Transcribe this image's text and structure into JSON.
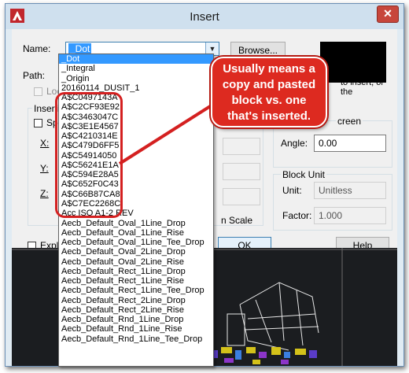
{
  "window": {
    "title": "Insert",
    "close_label": "✕"
  },
  "form": {
    "name_label": "Name:",
    "name_value": "_Dot",
    "browse_label": "Browse...",
    "path_label": "Path:",
    "locate_label": "Loca",
    "insertion_label": "Insertio",
    "specify_label": "Spe",
    "x_label": "X:",
    "y_label": "Y:",
    "z_label": "Z:",
    "explode_label": "Explo",
    "help_text_fragment": "to insert, or the",
    "screen_fragment": "creen",
    "angle_label": "Angle:",
    "angle_value": "0.00",
    "block_unit_label": "Block Unit",
    "unit_label": "Unit:",
    "unit_value": "Unitless",
    "factor_label": "Factor:",
    "factor_value": "1.000",
    "scale_fragment": "n Scale",
    "ok_label": "OK",
    "help_label": "Help"
  },
  "dropdown_items": [
    "_Dot",
    "_Integral",
    "_Origin",
    "20160114_DUSIT_1",
    "A$C0497143A",
    "A$C2CF93E92",
    "A$C3463047C",
    "A$C3E1E4567",
    "A$C4210314E",
    "A$C479D6FF5",
    "A$C54914050",
    "A$C56241E1A",
    "A$C594E28A5",
    "A$C652F0C43",
    "A$C66B87CA8",
    "A$C7EC2268C",
    "Acc ISO A1-2 REV",
    "Aecb_Default_Oval_1Line_Drop",
    "Aecb_Default_Oval_1Line_Rise",
    "Aecb_Default_Oval_1Line_Tee_Drop",
    "Aecb_Default_Oval_2Line_Drop",
    "Aecb_Default_Oval_2Line_Rise",
    "Aecb_Default_Rect_1Line_Drop",
    "Aecb_Default_Rect_1Line_Rise",
    "Aecb_Default_Rect_1Line_Tee_Drop",
    "Aecb_Default_Rect_2Line_Drop",
    "Aecb_Default_Rect_2Line_Rise",
    "Aecb_Default_Rnd_1Line_Drop",
    "Aecb_Default_Rnd_1Line_Rise",
    "Aecb_Default_Rnd_1Line_Tee_Drop"
  ],
  "callout": {
    "line1": "Usually means a",
    "line2": "copy and pasted",
    "line3": "block vs. one",
    "line4": "that's inserted."
  },
  "colors": {
    "accent_red": "#dd2a20",
    "selection_blue": "#3399ff",
    "title_bar": "#cfe0ee"
  }
}
